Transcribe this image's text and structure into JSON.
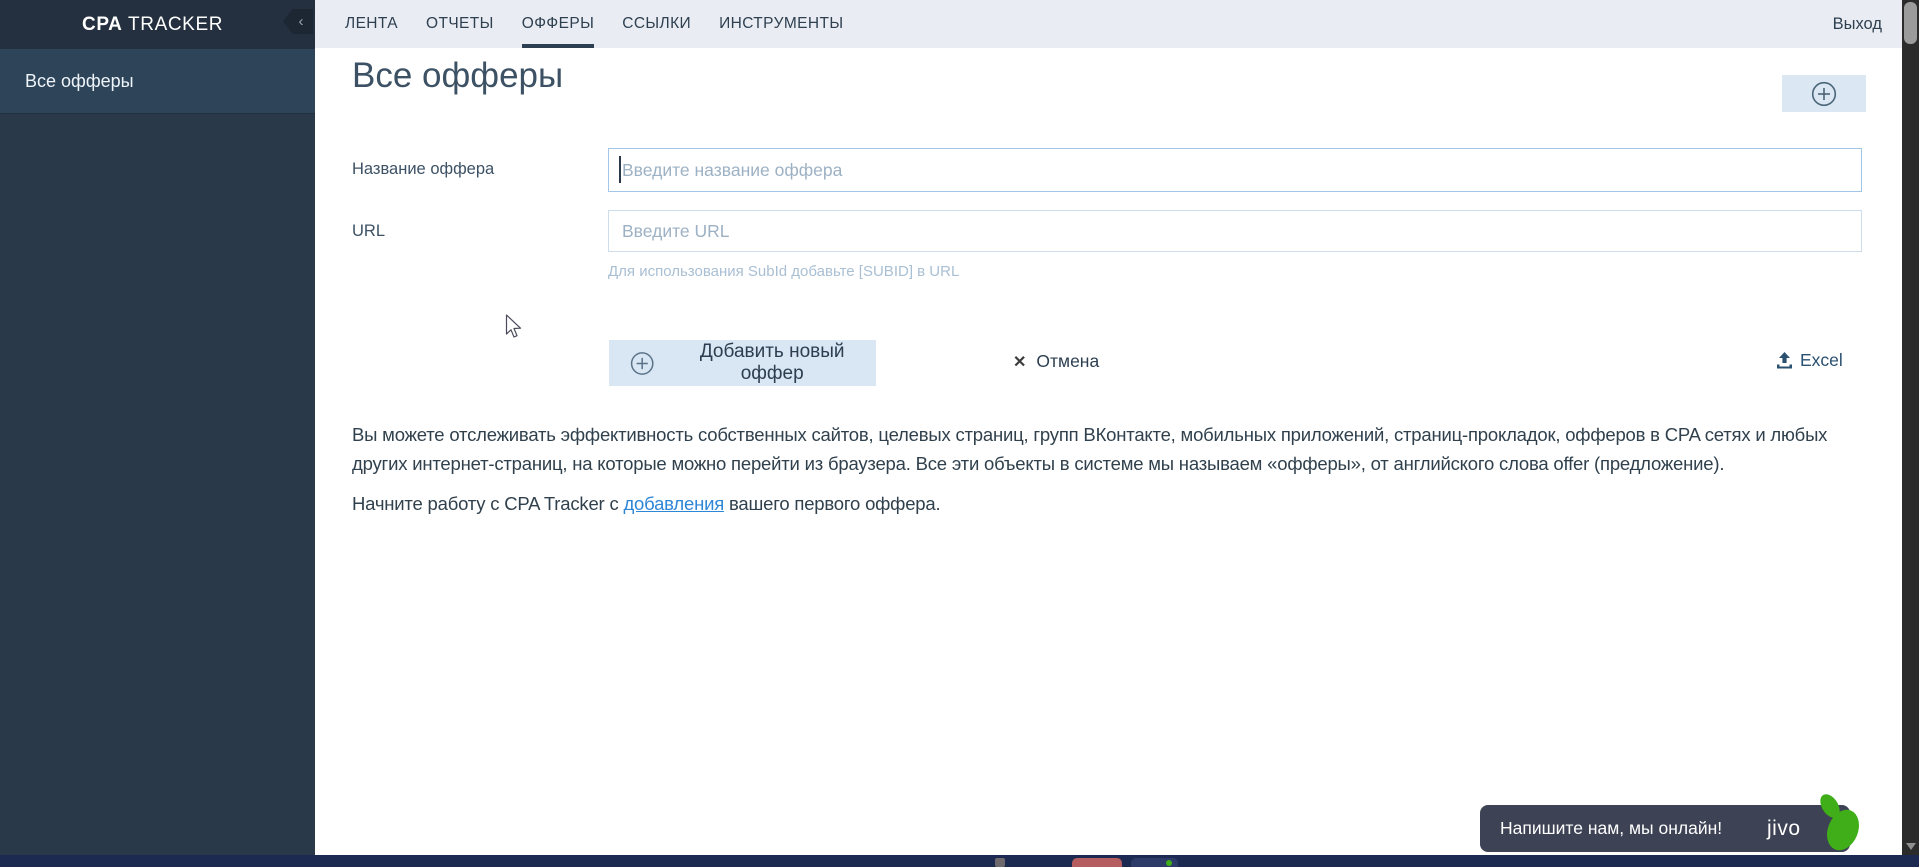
{
  "sidebar": {
    "logo_bold": "CPA",
    "logo_rest": " TRACKER",
    "collapse_icon": "‹",
    "items": [
      {
        "label": "Все офферы",
        "active": true
      }
    ]
  },
  "topnav": {
    "tabs": [
      {
        "label": "ЛЕНТА",
        "active": false
      },
      {
        "label": "ОТЧЕТЫ",
        "active": false
      },
      {
        "label": "ОФФЕРЫ",
        "active": true
      },
      {
        "label": "ССЫЛКИ",
        "active": false
      },
      {
        "label": "ИНСТРУМЕНТЫ",
        "active": false
      }
    ],
    "logout_label": "Выход"
  },
  "main": {
    "title": "Все офферы",
    "form": {
      "name_label": "Название оффера",
      "name_placeholder": "Введите название оффера",
      "name_value": "",
      "url_label": "URL",
      "url_placeholder": "Введите URL",
      "url_value": "",
      "url_hint": "Для использования SubId добавьте [SUBID] в URL",
      "submit_label": "Добавить новый оффер",
      "cancel_label": "Отмена",
      "cancel_icon": "✕",
      "excel_label": "Excel"
    },
    "description": "Вы можете отслеживать эффективность собственных сайтов, целевых страниц, групп ВКонтакте, мобильных приложений, страниц-прокладок, офферов в CPA сетях и любых других интернет-страниц, на которые можно перейти из браузера. Все эти объекты в системе мы называем «офферы», от английского слова offer (предложение).",
    "start_text_before": "Начните работу с CPA Tracker с ",
    "start_link": "добавления",
    "start_text_after": " вашего первого оффера."
  },
  "chat": {
    "message": "Напишите нам, мы онлайн!",
    "brand": "jivo"
  },
  "colors": {
    "sidebar_bg": "#293949",
    "sidebar_header_bg": "#24303f",
    "sidebar_active_bg": "#2e4458",
    "topnav_bg": "#e9edf3",
    "nav_text": "#2e3f50",
    "button_bg": "#d9e6f3",
    "input_focus_border": "#a3c6e8",
    "link_blue": "#2e86d6",
    "excel_blue": "#2b5170",
    "jivo_bg": "#3d4254",
    "jivo_green": "#3fae19",
    "taskbar_bg": "#1c2a52",
    "taskbar_red": "#b65d60"
  }
}
